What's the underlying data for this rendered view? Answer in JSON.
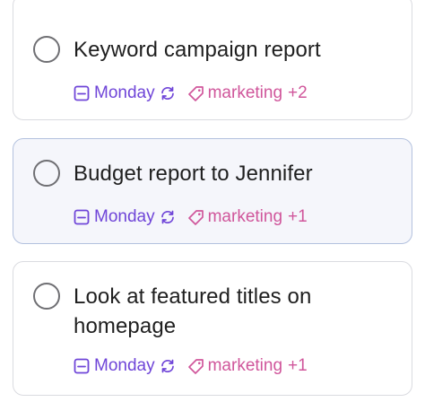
{
  "colors": {
    "date": "#6f45d8",
    "tag": "#d0569b",
    "selected_bg": "#f5f6fb",
    "selected_border": "#b3c1de",
    "card_border": "#dadbe0"
  },
  "icons": {
    "checkbox": "circle-checkbox-icon",
    "date": "calendar-icon",
    "repeat": "repeat-icon",
    "tag": "tag-icon"
  },
  "tasks": [
    {
      "title": "Keyword campaign report",
      "due": "Monday",
      "tag": "marketing",
      "extra_tags": "+2",
      "selected": false
    },
    {
      "title": "Budget report to Jennifer",
      "due": "Monday",
      "tag": "marketing",
      "extra_tags": "+1",
      "selected": true
    },
    {
      "title": "Look at featured titles on homepage",
      "due": "Monday",
      "tag": "marketing",
      "extra_tags": "+1",
      "selected": false
    }
  ]
}
